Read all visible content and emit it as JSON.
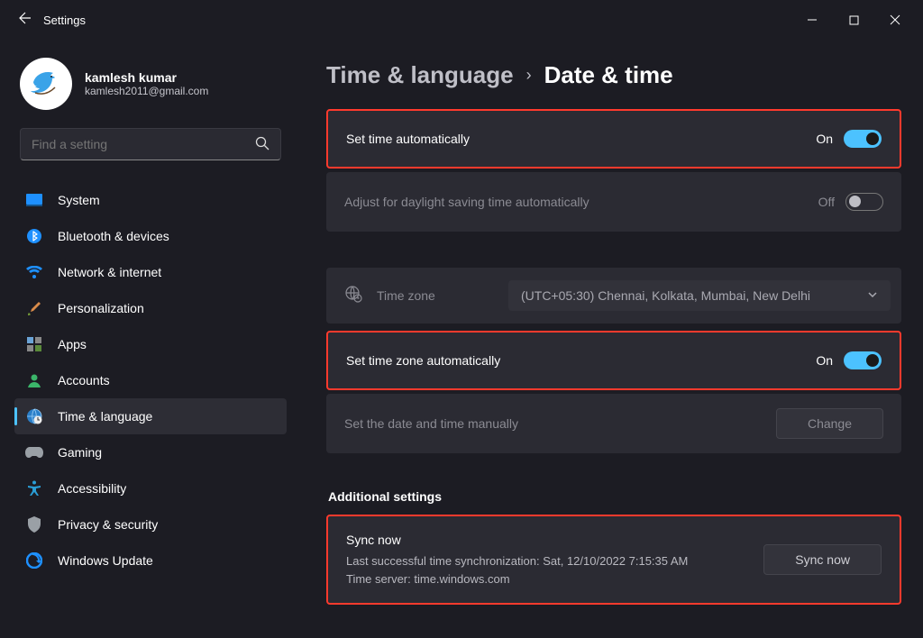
{
  "titlebar": {
    "app_title": "Settings"
  },
  "profile": {
    "name": "kamlesh kumar",
    "email": "kamlesh2011@gmail.com"
  },
  "search": {
    "placeholder": "Find a setting"
  },
  "sidebar": {
    "items": [
      {
        "label": "System"
      },
      {
        "label": "Bluetooth & devices"
      },
      {
        "label": "Network & internet"
      },
      {
        "label": "Personalization"
      },
      {
        "label": "Apps"
      },
      {
        "label": "Accounts"
      },
      {
        "label": "Time & language"
      },
      {
        "label": "Gaming"
      },
      {
        "label": "Accessibility"
      },
      {
        "label": "Privacy & security"
      },
      {
        "label": "Windows Update"
      }
    ]
  },
  "breadcrumb": {
    "parent": "Time & language",
    "current": "Date & time"
  },
  "settings": {
    "auto_time": {
      "label": "Set time automatically",
      "state": "On"
    },
    "daylight": {
      "label": "Adjust for daylight saving time automatically",
      "state": "Off"
    },
    "timezone": {
      "label": "Time zone",
      "value": "(UTC+05:30) Chennai, Kolkata, Mumbai, New Delhi"
    },
    "auto_tz": {
      "label": "Set time zone automatically",
      "state": "On"
    },
    "manual": {
      "label": "Set the date and time manually",
      "button": "Change"
    }
  },
  "additional": {
    "heading": "Additional settings",
    "sync": {
      "title": "Sync now",
      "last": "Last successful time synchronization: Sat, 12/10/2022 7:15:35 AM",
      "server": "Time server: time.windows.com",
      "button": "Sync now"
    }
  }
}
